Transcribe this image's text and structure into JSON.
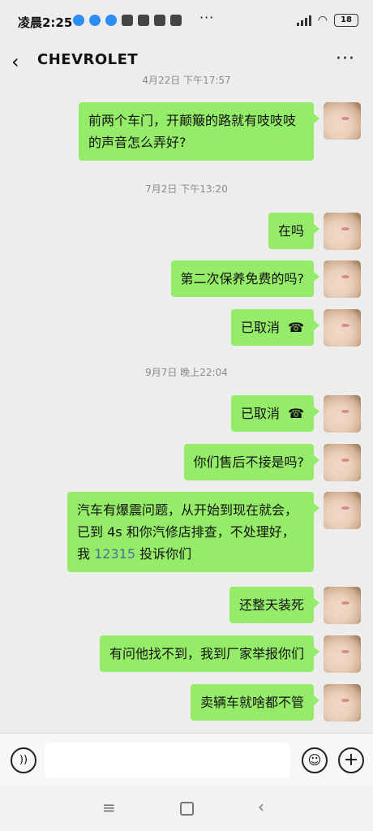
{
  "status_bar": {
    "time": "凌晨2:25",
    "more": "···",
    "battery": "18"
  },
  "header": {
    "back_icon": "‹",
    "title": "CHEVROLET",
    "menu_icon": "···"
  },
  "chat": {
    "timestamps": [
      "4月22日 下午17:57",
      "7月2日 下午13:20",
      "9月7日 晚上22:04"
    ],
    "messages": [
      {
        "text": "前两个车门，开颠簸的路就有吱吱吱的声音怎么弄好?"
      },
      {
        "text": "在吗"
      },
      {
        "text": "第二次保养免费的吗?"
      },
      {
        "text": "已取消",
        "hang_icon": "☎"
      },
      {
        "text": "已取消",
        "hang_icon": "☎"
      },
      {
        "text": "你们售后不接是吗?"
      },
      {
        "text_before": "汽车有爆震问题，从开始到现在就会，已到 4s 和你汽修店排查，不处理好，我 ",
        "link": "12315",
        "text_after": " 投诉你们"
      },
      {
        "text": "还整天装死"
      },
      {
        "text": "有问他找不到，我到厂家举报你们"
      },
      {
        "text": "卖辆车就啥都不管"
      }
    ]
  },
  "input_bar": {
    "voice_icon": "))",
    "emoji_icon": "☺",
    "plus_icon": "+"
  },
  "nav_bar": {
    "menu_icon": "≡",
    "home_icon": "□",
    "back_icon": "‹"
  }
}
